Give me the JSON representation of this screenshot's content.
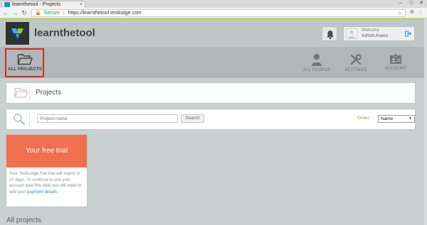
{
  "browser": {
    "tab_title": "learnthetool - Projects",
    "tab_close": "×",
    "window_controls": [
      "–",
      "□",
      "✕"
    ],
    "secure_label": "Secure",
    "url": "https://learnthetool.testlodge.com"
  },
  "header": {
    "brand": "learnthetool",
    "welcome_label": "Welcome",
    "user_name": "Ashish Anand"
  },
  "nav": {
    "all_projects": "ALL PROJECTS",
    "all_people": "ALL PEOPLE",
    "settings": "SETTINGS",
    "account": "ACCOUNT"
  },
  "projects": {
    "title": "Projects"
  },
  "search": {
    "placeholder": "Project name",
    "button": "Search",
    "order_label": "Order:",
    "order_value": "Name"
  },
  "trial": {
    "title": "Your free trial",
    "body": "Your TestLodge free trial will expire in 27 days. To continue to use your account past this date you will need to add your ",
    "link": "payment details",
    "end": "."
  },
  "section": {
    "all_projects_heading": "All projects"
  },
  "colors": {
    "accent": "#b8d34a",
    "trial": "#f0704f",
    "highlight": "#d9242a",
    "link": "#2f8cc4"
  }
}
